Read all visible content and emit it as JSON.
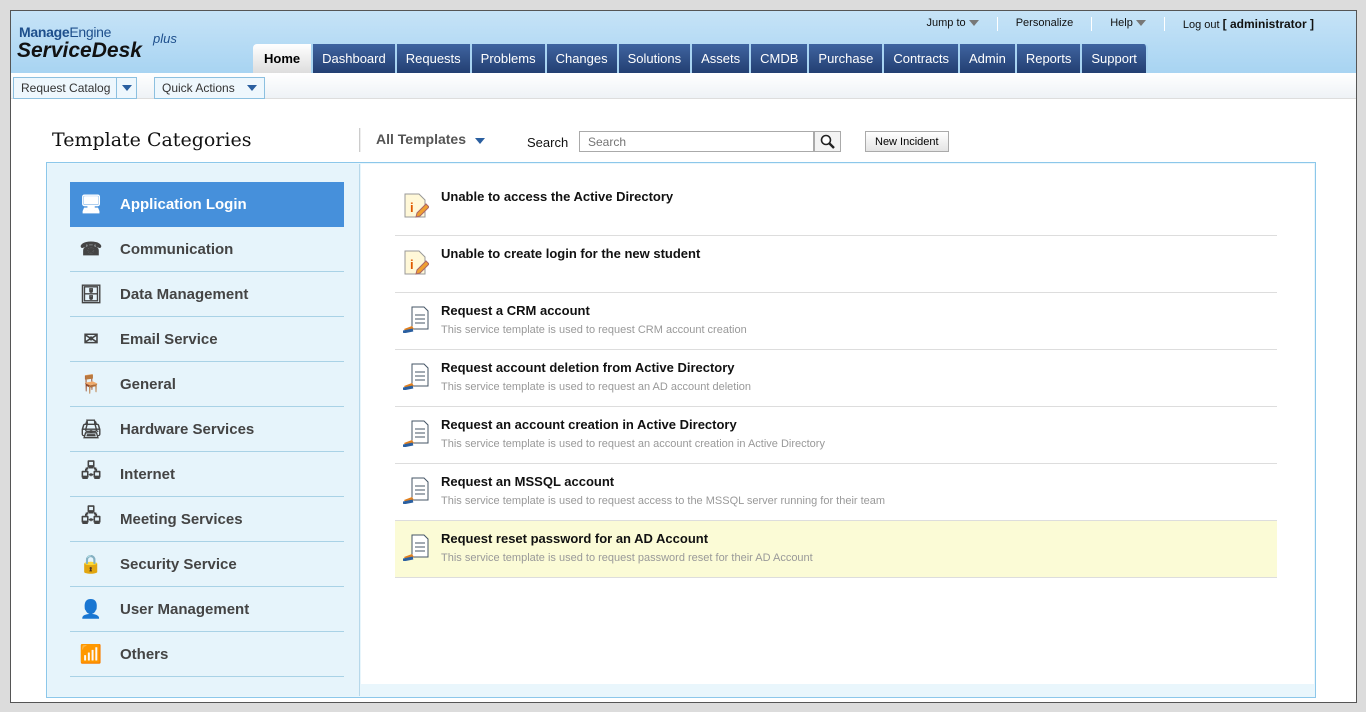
{
  "brand": {
    "line1a": "Manage",
    "line1b": "Engine",
    "line2": "ServiceDesk",
    "plus": "plus"
  },
  "toplinks": {
    "jump": "Jump to",
    "personalize": "Personalize",
    "help": "Help",
    "logout": "Log out",
    "user": "[ administrator ]"
  },
  "tabs": [
    "Home",
    "Dashboard",
    "Requests",
    "Problems",
    "Changes",
    "Solutions",
    "Assets",
    "CMDB",
    "Purchase",
    "Contracts",
    "Admin",
    "Reports",
    "Support"
  ],
  "toolbar": {
    "request_catalog": "Request Catalog",
    "quick_actions": "Quick Actions"
  },
  "page": {
    "title": "Template Categories",
    "filter": "All Templates",
    "search_label": "Search",
    "search_placeholder": "Search",
    "new_incident": "New Incident"
  },
  "categories": [
    {
      "label": "Application Login",
      "icon": "browser-icon"
    },
    {
      "label": "Communication",
      "icon": "phone-icon"
    },
    {
      "label": "Data Management",
      "icon": "server-icon"
    },
    {
      "label": "Email Service",
      "icon": "envelope-icon"
    },
    {
      "label": "General",
      "icon": "chair-icon"
    },
    {
      "label": "Hardware Services",
      "icon": "hardware-icon"
    },
    {
      "label": "Internet",
      "icon": "network-icon"
    },
    {
      "label": "Meeting Services",
      "icon": "network-icon"
    },
    {
      "label": "Security Service",
      "icon": "lock-icon"
    },
    {
      "label": "User Management",
      "icon": "user-icon"
    },
    {
      "label": "Others",
      "icon": "wifi-icon"
    }
  ],
  "templates": [
    {
      "title": "Unable to access the Active Directory",
      "desc": "",
      "type": "incident"
    },
    {
      "title": "Unable to create login for the new student",
      "desc": "",
      "type": "incident"
    },
    {
      "title": "Request a CRM account",
      "desc": "This service template is used to request CRM account creation",
      "type": "service"
    },
    {
      "title": "Request account deletion from Active Directory",
      "desc": "This service template is used to request an AD account deletion",
      "type": "service"
    },
    {
      "title": "Request an account creation in Active Directory",
      "desc": "This service template is used to request an account creation in Active Directory",
      "type": "service"
    },
    {
      "title": "Request an MSSQL account",
      "desc": "This service template is used to request access to the MSSQL server running for their team",
      "type": "service"
    },
    {
      "title": "Request reset password for an AD Account",
      "desc": "This service template is used to request password reset for their AD Account",
      "type": "service"
    }
  ]
}
